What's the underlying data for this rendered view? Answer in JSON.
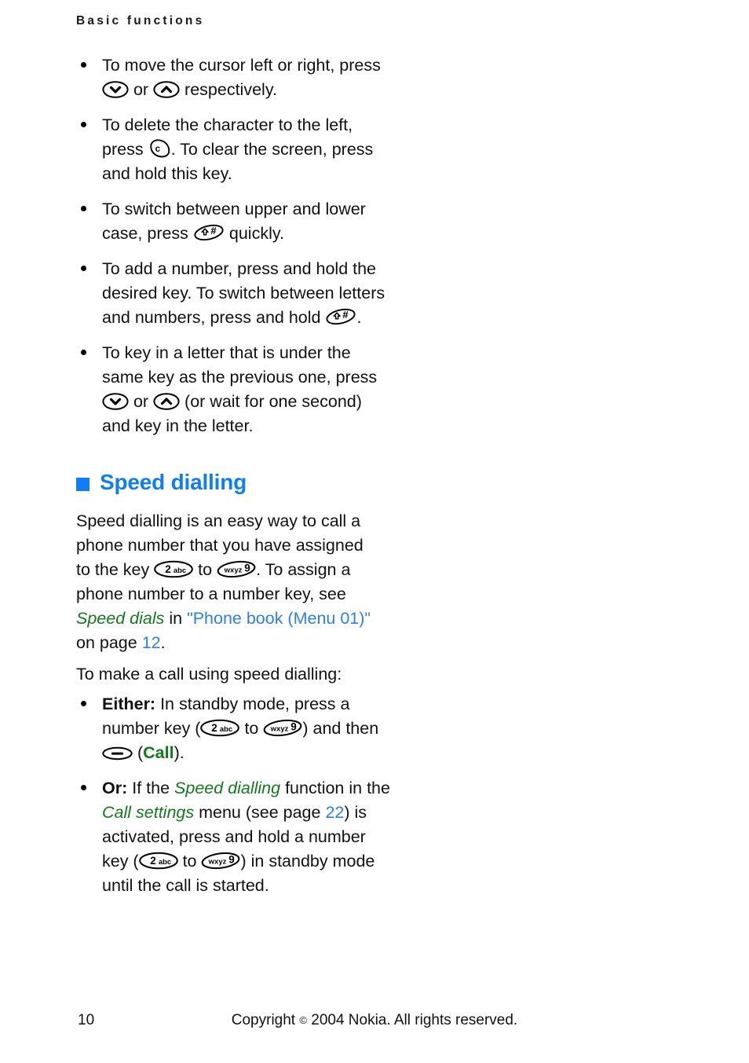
{
  "running_head": "Basic functions",
  "bullets_top": [
    {
      "id": "cursor-move",
      "segments": [
        {
          "t": "text",
          "v": "To move the cursor left or right, press "
        },
        {
          "t": "icon",
          "v": "key-down-arrow"
        },
        {
          "t": "text",
          "v": " or "
        },
        {
          "t": "icon",
          "v": "key-up-arrow"
        },
        {
          "t": "text",
          "v": " respectively."
        }
      ],
      "plain": "To move the cursor left or right, press (down) or (up) respectively."
    },
    {
      "id": "delete-character",
      "segments": [
        {
          "t": "text",
          "v": "To delete the character to the left, press "
        },
        {
          "t": "icon",
          "v": "key-clear-c"
        },
        {
          "t": "text",
          "v": ". To clear the screen, press and hold this key."
        }
      ],
      "plain": "To delete the character to the left, press (c). To clear the screen, press and hold this key."
    },
    {
      "id": "switch-case",
      "segments": [
        {
          "t": "text",
          "v": "To switch between upper and lower case, press "
        },
        {
          "t": "icon",
          "v": "key-shift-hash"
        },
        {
          "t": "text",
          "v": " quickly."
        }
      ],
      "plain": "To switch between upper and lower case, press (shift #) quickly."
    },
    {
      "id": "add-number",
      "segments": [
        {
          "t": "text",
          "v": "To add a number, press and hold the desired key. To switch between letters and numbers, press and hold "
        },
        {
          "t": "icon",
          "v": "key-shift-hash"
        },
        {
          "t": "text",
          "v": "."
        }
      ],
      "plain": "To add a number, press and hold the desired key. To switch between letters and numbers, press and hold (shift #)."
    },
    {
      "id": "same-key-letter",
      "segments": [
        {
          "t": "text",
          "v": "To key in a letter that is under the same key as the previous one, press "
        },
        {
          "t": "icon",
          "v": "key-down-arrow"
        },
        {
          "t": "text",
          "v": " or "
        },
        {
          "t": "icon",
          "v": "key-up-arrow"
        },
        {
          "t": "text",
          "v": " (or wait for one second) and key in the letter."
        }
      ],
      "plain": "To key in a letter that is under the same key as the previous one, press (down) or (up) (or wait for one second) and key in the letter."
    }
  ],
  "heading": {
    "square_color": "#0d7ef5",
    "text": "Speed dialling"
  },
  "paragraph_intro": {
    "s1": "Speed dialling is an easy way to call a phone number that you have assigned to the key ",
    "key_2abc": {
      "digit": "2",
      "letters": "abc"
    },
    "s2": " to ",
    "key_wxyz9": {
      "digit": "9",
      "letters": "wxyz"
    },
    "s3": ". To assign a phone number to a number key, see ",
    "emphasis_speed_dials": "Speed dials",
    "s4": " in ",
    "link_phone_book": "\"Phone book (Menu 01)\"",
    "s5": " on page ",
    "link_page": "12",
    "s6": "."
  },
  "paragraph_make_call": "To make a call using speed dialling:",
  "steps": [
    {
      "id": "either",
      "lead": "Either:",
      "s1": " In standby mode, press a number key (",
      "s2": " to ",
      "s3": ") and then ",
      "s4": " (",
      "call_label": "Call",
      "s5": ").",
      "plain": "Either: In standby mode, press a number key (2abc to wxyz9) and then (call key) (Call)."
    },
    {
      "id": "or",
      "lead": "Or:",
      "s1": "  If the ",
      "em1": "Speed dialling",
      "s2": " function in the ",
      "em2": "Call settings",
      "s3": " menu (see page ",
      "link_page": "22",
      "s4": ") is activated, press and hold a number key (",
      "s5": " to ",
      "s6": ") in standby mode until the call is started.",
      "plain": "Or: If the Speed dialling function in the Call settings menu (see page 22) is activated, press and hold a number key (2abc to wxyz9) in standby mode until the call is started."
    }
  ],
  "keys": {
    "key_2abc_digit": "2",
    "key_2abc_letters": "abc",
    "key_wxyz9_digit": "9",
    "key_wxyz9_letters": "wxyz",
    "key_clear_letter": "c",
    "key_hash_symbol": "#"
  },
  "footer": {
    "page_number": "10",
    "copyright": "Copyright © 2004 Nokia. All rights reserved.",
    "copyright_prefix": "Copyright ",
    "copyright_suffix": " 2004 Nokia. All rights reserved."
  },
  "colors": {
    "heading_blue": "#0d7ef5",
    "link_blue": "#2b7ff0",
    "emphasis_green": "#117a1b",
    "body_black": "#111111"
  }
}
